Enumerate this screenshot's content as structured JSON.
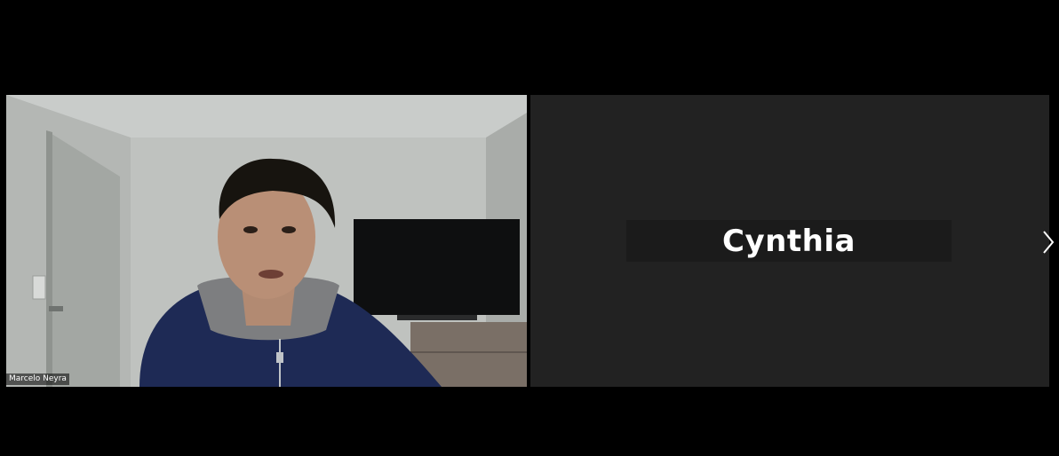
{
  "participants": [
    {
      "name": "Marcelo Neyra",
      "video": "camera-on"
    },
    {
      "name": "Cynthia",
      "video": "camera-off"
    }
  ],
  "colors": {
    "background": "#000000",
    "avatar_tile": "#222222",
    "name_plate": "#1b1b1b",
    "text": "#ffffff"
  },
  "icons": {
    "next_page": "chevron-right-icon"
  }
}
